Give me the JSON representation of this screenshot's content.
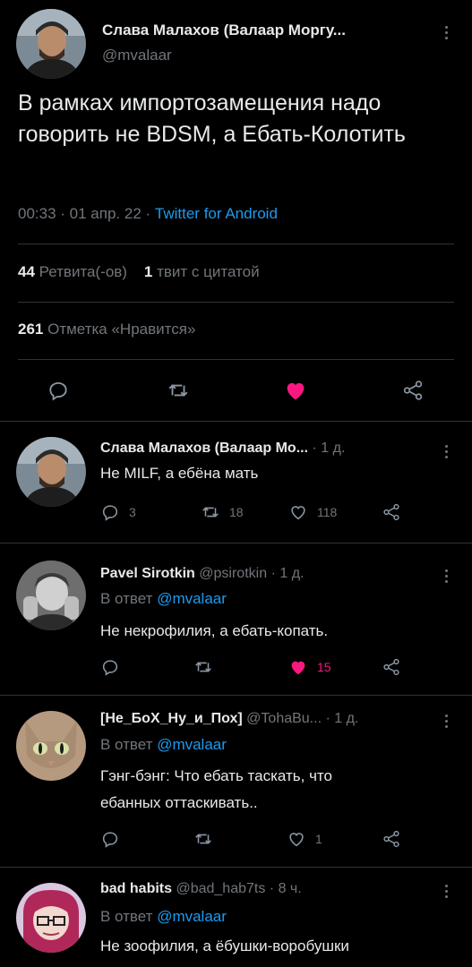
{
  "main_tweet": {
    "author_name": "Слава Малахов (Валаар Моргу...",
    "handle": "@mvalaar",
    "text": "В рамках импортозамещения надо говорить не BDSM, а Ебать-Колотить",
    "time": "00:33",
    "date": "01 апр. 22",
    "client": "Twitter for Android",
    "retweets_count": "44",
    "retweets_label": "Ретвита(-ов)",
    "quotes_count": "1",
    "quotes_label": "твит с цитатой",
    "likes_count": "261",
    "likes_label": "Отметка «Нравится»",
    "liked": true
  },
  "colors": {
    "like": "#f91880",
    "link": "#1d9bf0",
    "muted": "#71767b",
    "text": "#e7e9ea"
  },
  "replies": [
    {
      "name": "Слава Малахов (Валаар Мо...",
      "handle": "",
      "time": "1 д.",
      "reply_to_prefix": "",
      "reply_to": "",
      "text": "Не MILF, а ебёна мать",
      "reply_count": "3",
      "retweet_count": "18",
      "like_count": "118",
      "liked": false
    },
    {
      "name": "Pavel Sirotkin",
      "handle": "@psirotkin",
      "time": "1 д.",
      "reply_to_prefix": "В ответ",
      "reply_to": "@mvalaar",
      "text": "Не некрофилия, а ебать-копать.",
      "reply_count": "",
      "retweet_count": "",
      "like_count": "15",
      "liked": true
    },
    {
      "name": "[Не_БоХ_Ну_и_Пох]",
      "handle": "@TohaBu...",
      "time": "1 д.",
      "reply_to_prefix": "В ответ",
      "reply_to": "@mvalaar",
      "text_line1": "Гэнг-бэнг: Что ебать таскать, что",
      "text_line2": "ебанных оттаскивать..",
      "reply_count": "",
      "retweet_count": "",
      "like_count": "1",
      "liked": false
    },
    {
      "name": "bad habits",
      "handle": "@bad_hab7ts",
      "time": "8 ч.",
      "reply_to_prefix": "В ответ",
      "reply_to": "@mvalaar",
      "text": "Не зоофилия, а ёбушки-воробушки"
    }
  ]
}
